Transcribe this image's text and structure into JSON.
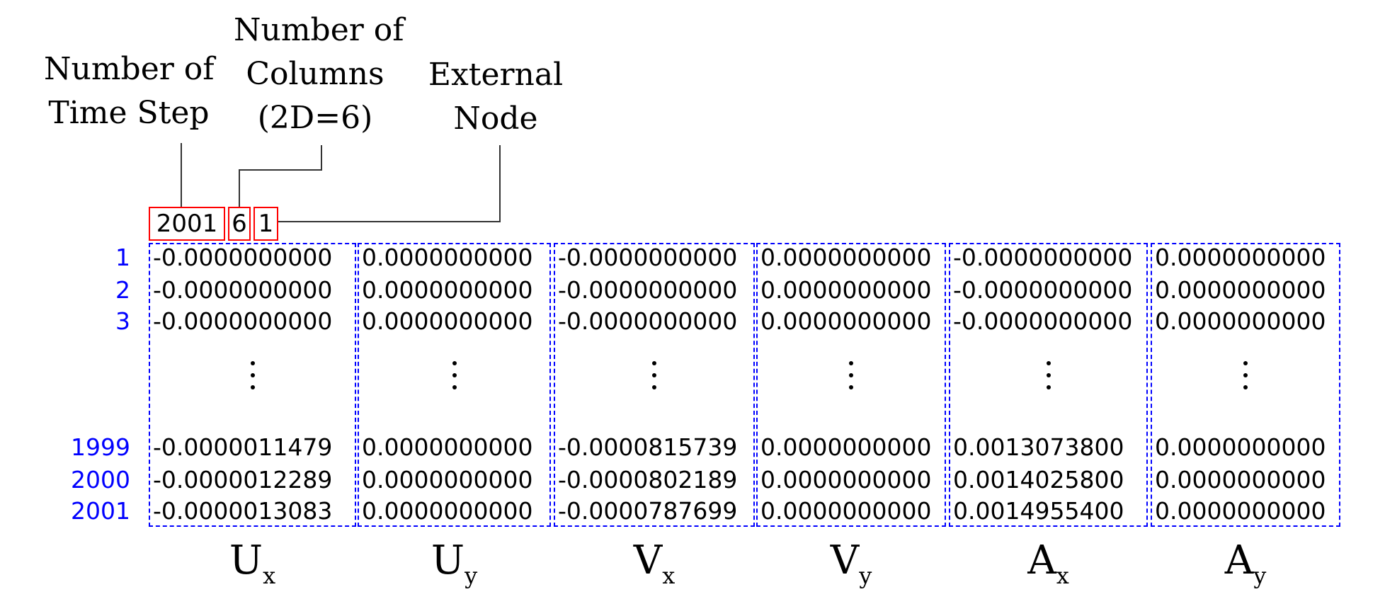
{
  "annotations": {
    "time_steps": [
      "Number of",
      "Time Step"
    ],
    "columns": [
      "Number of",
      "Columns",
      "(2D=6)"
    ],
    "external_node": [
      "External",
      "Node"
    ]
  },
  "header": {
    "time_steps": "2001",
    "columns": "6",
    "node": "1"
  },
  "rows": {
    "labels": [
      "1",
      "2",
      "3",
      "1999",
      "2000",
      "2001"
    ]
  },
  "columns": [
    {
      "symbol": "U",
      "sub": "x",
      "values": [
        "-0.0000000000",
        "-0.0000000000",
        "-0.0000000000",
        "-0.0000011479",
        "-0.0000012289",
        "-0.0000013083"
      ]
    },
    {
      "symbol": "U",
      "sub": "y",
      "values": [
        "0.0000000000",
        "0.0000000000",
        "0.0000000000",
        "0.0000000000",
        "0.0000000000",
        "0.0000000000"
      ]
    },
    {
      "symbol": "V",
      "sub": "x",
      "values": [
        "-0.0000000000",
        "-0.0000000000",
        "-0.0000000000",
        "-0.0000815739",
        "-0.0000802189",
        "-0.0000787699"
      ]
    },
    {
      "symbol": "V",
      "sub": "y",
      "values": [
        "0.0000000000",
        "0.0000000000",
        "0.0000000000",
        "0.0000000000",
        "0.0000000000",
        "0.0000000000"
      ]
    },
    {
      "symbol": "A",
      "sub": "x",
      "values": [
        "-0.0000000000",
        "-0.0000000000",
        "-0.0000000000",
        "0.0013073800",
        "0.0014025800",
        "0.0014955400"
      ]
    },
    {
      "symbol": "A",
      "sub": "y",
      "values": [
        "0.0000000000",
        "0.0000000000",
        "0.0000000000",
        "0.0000000000",
        "0.0000000000",
        "0.0000000000"
      ]
    }
  ],
  "colors": {
    "header_box": "#ff0000",
    "column_box": "#0000ff",
    "row_label": "#0000ff",
    "text": "#000000"
  }
}
